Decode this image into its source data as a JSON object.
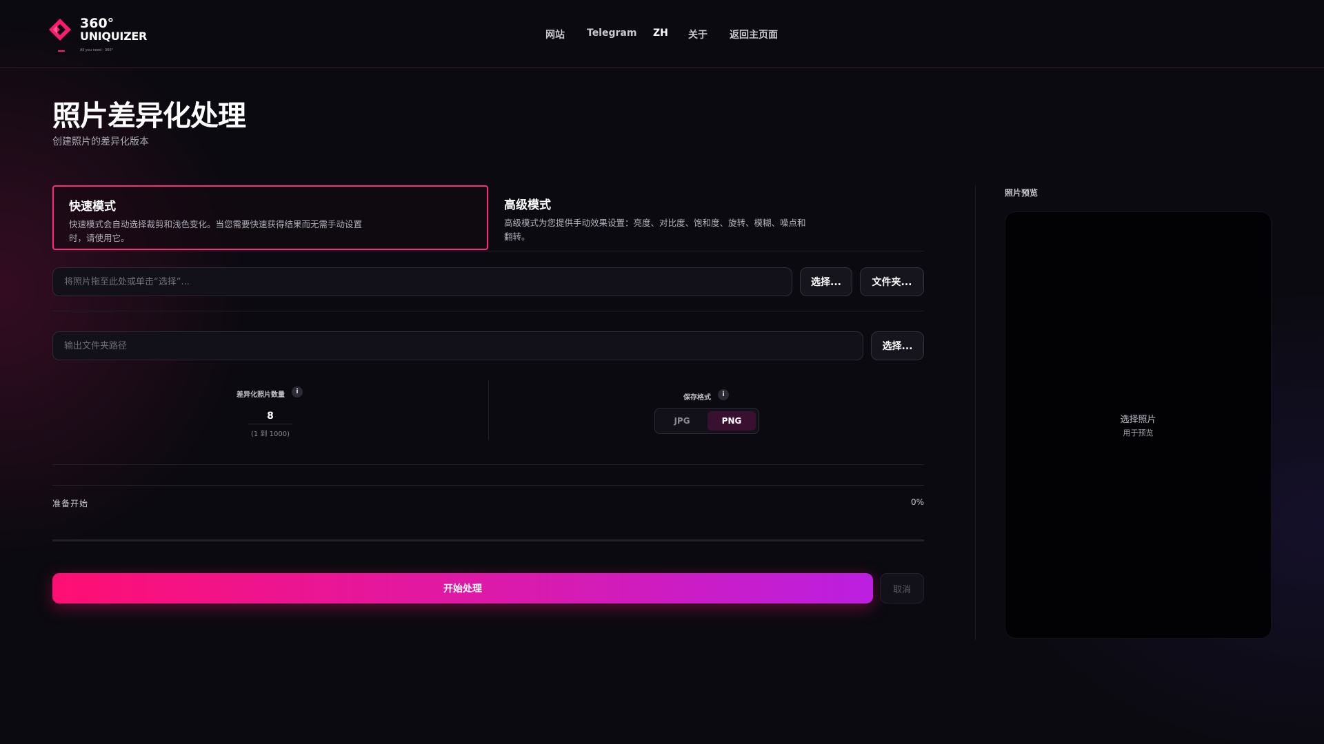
{
  "brand": {
    "name_line1": "360°",
    "name_line2": "UNIQUIZER",
    "tagline": "All you need - 360°",
    "accent": "#ff1a6e"
  },
  "nav": {
    "items": [
      {
        "label": "网站"
      },
      {
        "label": "Telegram"
      },
      {
        "label": "ZH",
        "active": true
      },
      {
        "label": "关于"
      },
      {
        "label": "返回主页面"
      }
    ]
  },
  "page": {
    "title": "照片差异化处理",
    "subtitle": "创建照片的差异化版本"
  },
  "modes": {
    "quick": {
      "title": "快速模式",
      "desc": "快速模式会自动选择裁剪和浅色变化。当您需要快速获得结果而无需手动设置时，请使用它。",
      "selected": true
    },
    "advanced": {
      "title": "高级模式",
      "desc": "高级模式为您提供手动效果设置：亮度、对比度、饱和度、旋转、模糊、噪点和翻转。"
    }
  },
  "input": {
    "placeholder": "将照片拖至此处或单击“选择”...",
    "select_label": "选择...",
    "folder_label": "文件夹..."
  },
  "output": {
    "placeholder": "输出文件夹路径",
    "select_label": "选择..."
  },
  "settings": {
    "count_label": "差异化照片数量",
    "count_value": "8",
    "count_range": "(1 到 1000)",
    "format_label": "保存格式",
    "info_glyph": "i",
    "formats": [
      "JPG",
      "PNG"
    ],
    "selected_format": "PNG"
  },
  "progress": {
    "status": "准备开始",
    "percent_label": "0%",
    "fraction": 0
  },
  "actions": {
    "start_label": "开始处理",
    "cancel_label": "取消"
  },
  "preview": {
    "label": "照片预览",
    "hint_line1": "选择照片",
    "hint_line2": "用于预览"
  }
}
